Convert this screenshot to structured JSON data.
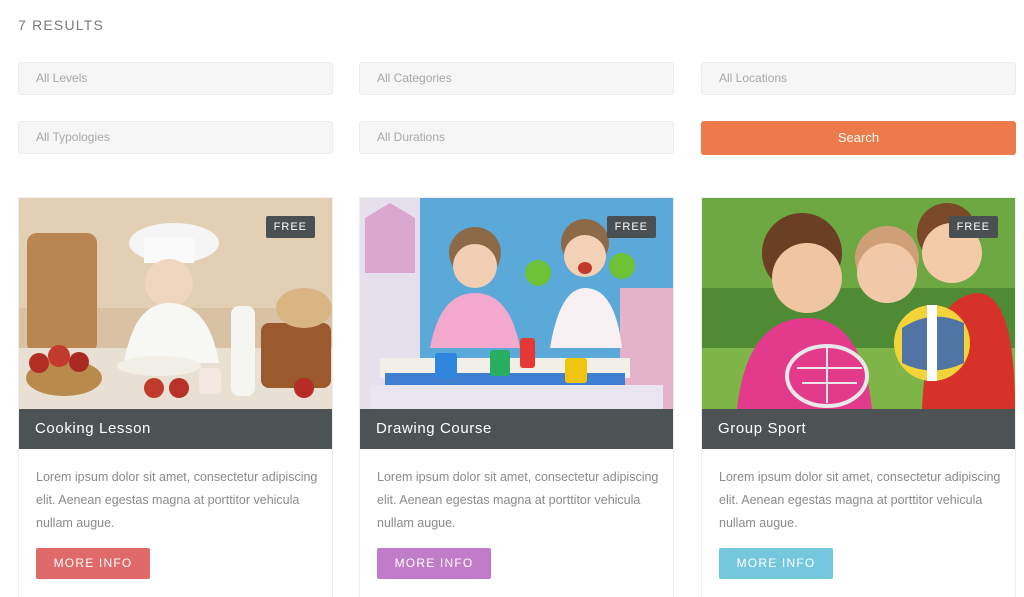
{
  "results_label": "7 RESULTS",
  "filters": {
    "levels": "All Levels",
    "categories": "All Categories",
    "locations": "All Locations",
    "typologies": "All Typologies",
    "durations": "All Durations",
    "search_label": "Search"
  },
  "colors": {
    "search": "#ec7a4b",
    "btn_cooking": "#e06a6a",
    "btn_drawing": "#c07cc9",
    "btn_sport": "#74c7dd"
  },
  "cards": [
    {
      "badge": "FREE",
      "title": "Cooking Lesson",
      "description": "Lorem ipsum dolor sit amet, consectetur adipiscing elit. Aenean egestas magna at porttitor vehicula nullam augue.",
      "button": "MORE INFO"
    },
    {
      "badge": "FREE",
      "title": "Drawing Course",
      "description": "Lorem ipsum dolor sit amet, consectetur adipiscing elit. Aenean egestas magna at porttitor vehicula nullam augue.",
      "button": "MORE INFO"
    },
    {
      "badge": "FREE",
      "title": "Group Sport",
      "description": "Lorem ipsum dolor sit amet, consectetur adipiscing elit. Aenean egestas magna at porttitor vehicula nullam augue.",
      "button": "MORE INFO"
    }
  ]
}
